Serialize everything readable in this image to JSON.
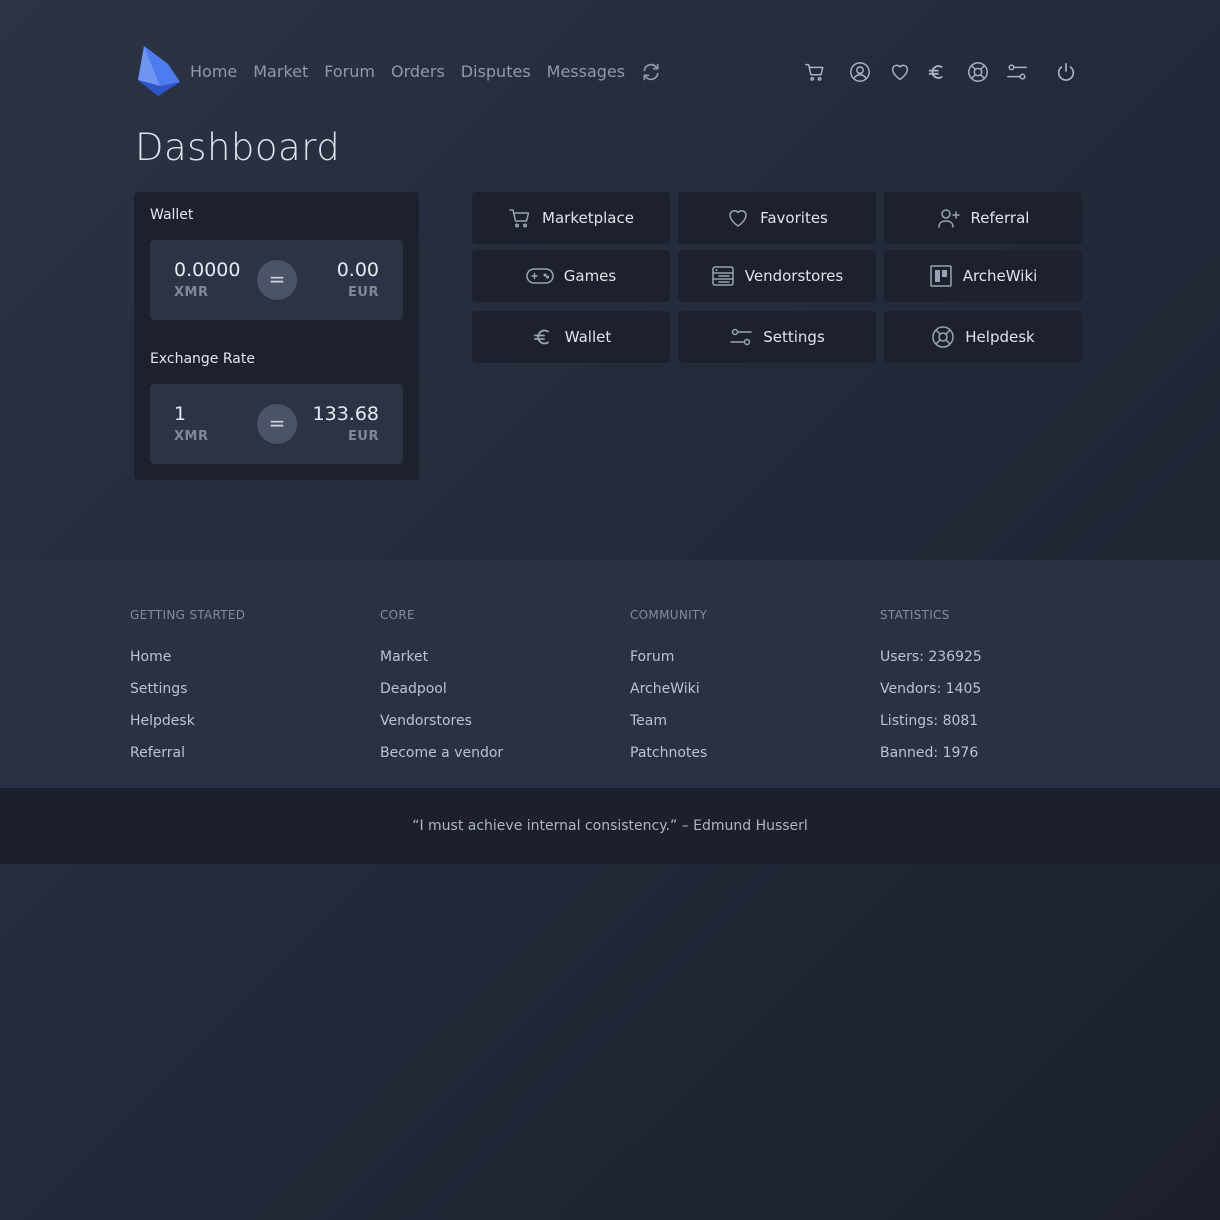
{
  "nav": {
    "links": [
      "Home",
      "Market",
      "Forum",
      "Orders",
      "Disputes",
      "Messages"
    ],
    "icons": [
      "refresh-icon",
      "cart-icon",
      "user-icon",
      "heart-icon",
      "euro-icon",
      "lifebuoy-icon",
      "sliders-icon",
      "power-icon"
    ]
  },
  "page": {
    "title": "Dashboard"
  },
  "wallet": {
    "label": "Wallet",
    "xmr_amount": "0.0000",
    "xmr_unit": "XMR",
    "eur_amount": "0.00",
    "eur_unit": "EUR",
    "equals": "="
  },
  "exchange": {
    "label": "Exchange Rate",
    "xmr_amount": "1",
    "xmr_unit": "XMR",
    "eur_amount": "133.68",
    "eur_unit": "EUR",
    "equals": "="
  },
  "tiles": [
    {
      "label": "Marketplace",
      "icon": "cart-icon"
    },
    {
      "label": "Favorites",
      "icon": "heart-icon"
    },
    {
      "label": "Referral",
      "icon": "user-plus-icon"
    },
    {
      "label": "Games",
      "icon": "gamepad-icon"
    },
    {
      "label": "Vendorstores",
      "icon": "server-icon"
    },
    {
      "label": "ArcheWiki",
      "icon": "board-icon"
    },
    {
      "label": "Wallet",
      "icon": "euro-icon"
    },
    {
      "label": "Settings",
      "icon": "sliders-icon"
    },
    {
      "label": "Helpdesk",
      "icon": "lifebuoy-icon"
    }
  ],
  "footer": {
    "columns": [
      {
        "heading": "GETTING STARTED",
        "links": [
          "Home",
          "Settings",
          "Helpdesk",
          "Referral"
        ]
      },
      {
        "heading": "CORE",
        "links": [
          "Market",
          "Deadpool",
          "Vendorstores",
          "Become a vendor"
        ]
      },
      {
        "heading": "COMMUNITY",
        "links": [
          "Forum",
          "ArcheWiki",
          "Team",
          "Patchnotes"
        ]
      },
      {
        "heading": "STATISTICS",
        "stats": [
          "Users: 236925",
          "Vendors: 1405",
          "Listings: 8081",
          "Banned: 1976"
        ]
      }
    ],
    "quote": "“I must achieve internal consistency.” – Edmund Husserl"
  },
  "colors": {
    "accent_blue": "#4f7cf0",
    "card_bg": "#1c212d",
    "footer_bg": "#293142",
    "footer_bottom_bg": "#1c202c"
  }
}
